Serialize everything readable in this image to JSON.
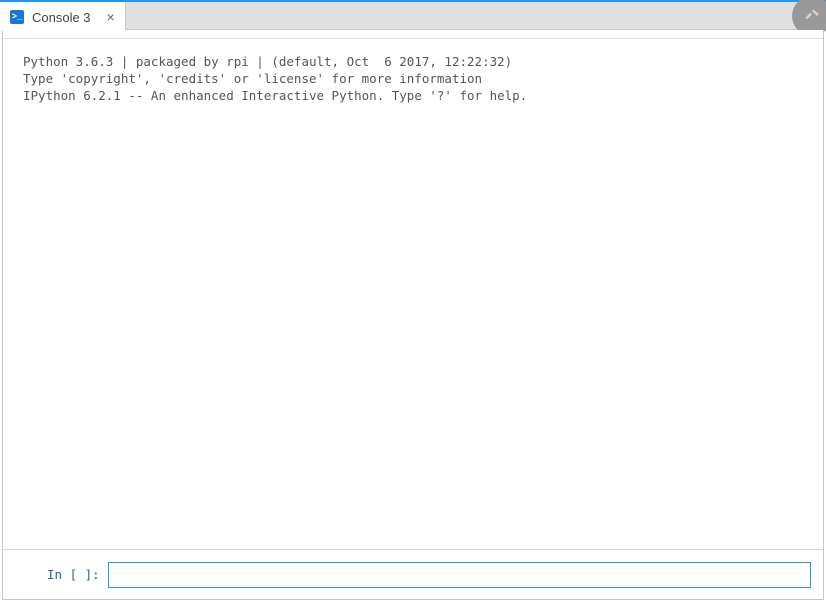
{
  "tab": {
    "icon_glyph": ">_",
    "label": "Console 3",
    "close_glyph": "×"
  },
  "console": {
    "banner_line1": "Python 3.6.3 | packaged by rpi | (default, Oct  6 2017, 12:22:32)",
    "banner_line2": "Type 'copyright', 'credits' or 'license' for more information",
    "banner_line3": "IPython 6.2.1 -- An enhanced Interactive Python. Type '?' for help."
  },
  "prompt": {
    "label": "In [ ]:",
    "value": ""
  }
}
